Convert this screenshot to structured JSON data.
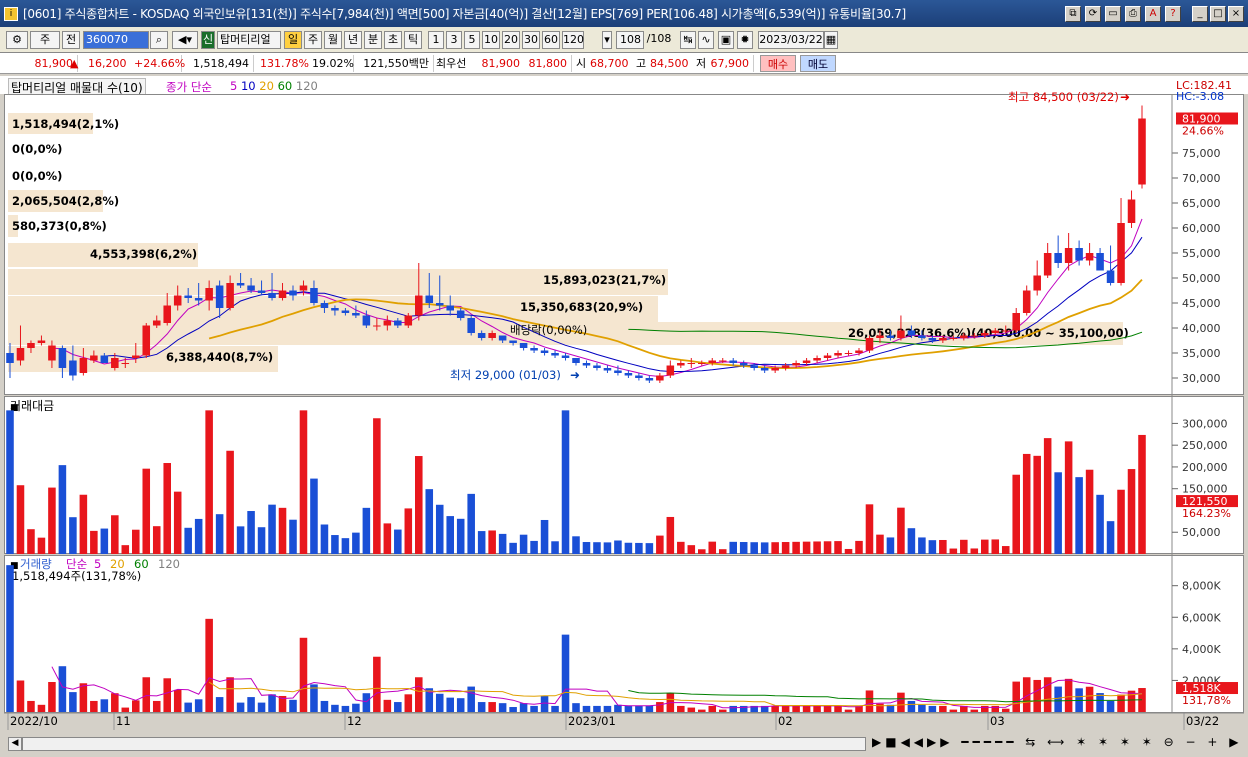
{
  "title": "[0601] 주식종합차트 - KOSDAQ 외국인보유[131(천)] 주식수[7,984(천)] 액면[500] 자본금[40(억)] 결산[12월] EPS[769] PER[106.48] 시가총액[6,539(억)] 유통비율[30.7]",
  "toolbar": {
    "period": "주",
    "code": "360070",
    "stock_name": "탑머티리얼",
    "timeframes": [
      "일",
      "주",
      "월",
      "년",
      "분",
      "초",
      "틱"
    ],
    "intervals": [
      "1",
      "3",
      "5",
      "10",
      "20",
      "30",
      "60",
      "120"
    ],
    "count": "108",
    "total": "/108",
    "date": "2023/03/22",
    "jeon": "전",
    "sin": "신"
  },
  "pricebar": {
    "price": "81,900",
    "arrow": "▲",
    "change": "16,200",
    "change_pct": "+24.66%",
    "volume": "1,518,494",
    "volume_ratio": "131.78%",
    "turnover": "19.02%",
    "amount": "121,550백만",
    "choiwoo": "최우선",
    "ask": "81,900",
    "bid": "81,800",
    "open_label": "시",
    "open": "68,700",
    "high_label": "고",
    "high": "84,500",
    "low_label": "저",
    "low": "67,900",
    "buy": "매수",
    "sell": "매도"
  },
  "legend": {
    "name": "탑머티리얼 매물대 수(10)",
    "ma_label": "종가 단순",
    "periods": [
      "5",
      "10",
      "20",
      "60",
      "120"
    ],
    "ma_colors": [
      "#c000c0",
      "#0000c0",
      "#e0a000",
      "#008000",
      "#808080"
    ]
  },
  "price_axis": {
    "lc": "LC:182.41",
    "hc": "HC:-3.08",
    "current": "81,900",
    "pct": "24.66%",
    "ticks": [
      "75,000",
      "70,000",
      "65,000",
      "60,000",
      "55,000",
      "50,000",
      "45,000",
      "40,000",
      "35,000",
      "30,000"
    ]
  },
  "volume_profile": [
    "1,518,494(2,1%)",
    "0(0,0%)",
    "0(0,0%)",
    "2,065,504(2,8%)",
    "580,373(0,8%)",
    "4,553,398(6,2%)",
    "15,893,023(21,7%)",
    "15,350,683(20,9%)",
    "6,388,440(8,7%)",
    "26,059,228(36,6%)(40,300,00 ~ 35,100,00)"
  ],
  "annotations": {
    "high": "최고 84,500 (03/22)",
    "low": "최저 29,000 (01/03)",
    "dividend": "배당락(0,00%)"
  },
  "amount_panel": {
    "title": "거래대금",
    "ticks": [
      "300,000",
      "250,000",
      "200,000",
      "150,000",
      "50,000"
    ],
    "current": "121,550",
    "pct": "164.23%"
  },
  "volume_panel": {
    "title": "거래량",
    "ma_label": "단순",
    "periods": [
      "5",
      "20",
      "60",
      "120"
    ],
    "value_text": "1,518,494주(131,78%)",
    "ticks": [
      "8,000K",
      "6,000K",
      "4,000K",
      "2,000K"
    ],
    "current": "1,518K",
    "pct": "131,78%"
  },
  "xaxis": [
    "2022/10",
    "11",
    "12",
    "2023/01",
    "02",
    "03",
    "03/22"
  ],
  "chart_data": {
    "type": "candlestick",
    "title": "탑머티리얼",
    "ylim": [
      26000,
      86000
    ],
    "candles": [
      [
        35000,
        37000,
        30000,
        33000
      ],
      [
        33500,
        40500,
        32500,
        36000
      ],
      [
        36000,
        37500,
        35000,
        37000
      ],
      [
        37000,
        38500,
        36500,
        37500
      ],
      [
        33500,
        37500,
        32000,
        36500
      ],
      [
        36000,
        36500,
        30000,
        32000
      ],
      [
        33500,
        36500,
        29500,
        30500
      ],
      [
        31000,
        36000,
        30500,
        34000
      ],
      [
        33500,
        35500,
        33000,
        34500
      ],
      [
        34500,
        35000,
        33000,
        33000
      ],
      [
        32000,
        35000,
        31500,
        34000
      ],
      [
        33000,
        34000,
        32000,
        33000
      ],
      [
        34000,
        37000,
        33000,
        34500
      ],
      [
        34500,
        41000,
        34000,
        40500
      ],
      [
        40500,
        42500,
        40000,
        41500
      ],
      [
        41000,
        47000,
        40500,
        44500
      ],
      [
        44500,
        48500,
        43500,
        46500
      ],
      [
        46500,
        48000,
        45000,
        46000
      ],
      [
        46000,
        49000,
        44500,
        45500
      ],
      [
        45500,
        49500,
        43500,
        48000
      ],
      [
        48500,
        49500,
        42000,
        44000
      ],
      [
        44000,
        50500,
        43500,
        49000
      ],
      [
        49000,
        51000,
        48000,
        48500
      ],
      [
        48500,
        50000,
        47000,
        47500
      ],
      [
        47500,
        49500,
        46500,
        47000
      ],
      [
        47000,
        51000,
        45500,
        46000
      ],
      [
        46000,
        49000,
        45500,
        47500
      ],
      [
        47500,
        48500,
        45500,
        46500
      ],
      [
        47500,
        49500,
        46500,
        48500
      ],
      [
        48000,
        49500,
        44500,
        45000
      ],
      [
        45000,
        45500,
        43000,
        44000
      ],
      [
        44000,
        44500,
        42500,
        43500
      ],
      [
        43500,
        44000,
        42500,
        43000
      ],
      [
        43000,
        44500,
        42000,
        42500
      ],
      [
        42500,
        43500,
        40000,
        40500
      ],
      [
        40500,
        42000,
        39500,
        40500
      ],
      [
        40500,
        42500,
        39500,
        41500
      ],
      [
        41500,
        42000,
        40000,
        40500
      ],
      [
        40500,
        43000,
        40000,
        42500
      ],
      [
        42500,
        53000,
        41500,
        46500
      ],
      [
        46500,
        51000,
        44000,
        45000
      ],
      [
        45000,
        50500,
        43500,
        44500
      ],
      [
        44500,
        46500,
        42500,
        43500
      ],
      [
        43500,
        44000,
        41500,
        42000
      ],
      [
        42000,
        42500,
        38500,
        39000
      ],
      [
        39000,
        39500,
        37500,
        38000
      ],
      [
        38000,
        39500,
        37500,
        39000
      ],
      [
        38500,
        38500,
        37000,
        37500
      ],
      [
        37500,
        37500,
        36500,
        37000
      ],
      [
        37000,
        37000,
        35500,
        36000
      ],
      [
        36000,
        36500,
        35000,
        35500
      ],
      [
        35500,
        36000,
        34500,
        35000
      ],
      [
        35000,
        35500,
        34000,
        34500
      ],
      [
        34500,
        35000,
        33500,
        34000
      ],
      [
        34000,
        34000,
        32500,
        33000
      ],
      [
        33000,
        33500,
        32000,
        32500
      ],
      [
        32500,
        33000,
        31500,
        32000
      ],
      [
        32000,
        32500,
        31000,
        31500
      ],
      [
        31500,
        32500,
        30500,
        31000
      ],
      [
        31000,
        31500,
        30000,
        30500
      ],
      [
        30500,
        31000,
        29500,
        30000
      ],
      [
        30000,
        30500,
        29000,
        29500
      ],
      [
        29500,
        31000,
        29000,
        30500
      ],
      [
        30500,
        33500,
        30000,
        32500
      ],
      [
        32500,
        33500,
        32000,
        33000
      ],
      [
        33000,
        34000,
        32000,
        33000
      ],
      [
        33000,
        33500,
        32500,
        33000
      ],
      [
        33000,
        34000,
        32500,
        33500
      ],
      [
        33500,
        34000,
        33000,
        33500
      ],
      [
        33500,
        34000,
        32500,
        33000
      ],
      [
        33000,
        33500,
        32000,
        32500
      ],
      [
        32500,
        33000,
        31500,
        32000
      ],
      [
        32000,
        32500,
        31000,
        31500
      ],
      [
        31500,
        32500,
        31000,
        32000
      ],
      [
        32000,
        33000,
        31500,
        32500
      ],
      [
        32500,
        33500,
        32000,
        33000
      ],
      [
        33000,
        34000,
        32500,
        33500
      ],
      [
        33500,
        34500,
        33000,
        34000
      ],
      [
        34000,
        35000,
        33500,
        34500
      ],
      [
        34500,
        35500,
        34000,
        35000
      ],
      [
        35000,
        35500,
        34500,
        35000
      ],
      [
        35000,
        36000,
        34500,
        35500
      ],
      [
        35500,
        38500,
        35000,
        38000
      ],
      [
        38000,
        39500,
        37000,
        38500
      ],
      [
        38500,
        39500,
        37500,
        38000
      ],
      [
        38000,
        42500,
        37500,
        39500
      ],
      [
        39500,
        40500,
        38000,
        38500
      ],
      [
        38500,
        39500,
        37500,
        38000
      ],
      [
        38000,
        38500,
        37000,
        37500
      ],
      [
        37500,
        38500,
        37000,
        38000
      ],
      [
        38000,
        38500,
        37500,
        38000
      ],
      [
        38000,
        39000,
        37500,
        38500
      ],
      [
        38500,
        39000,
        38000,
        38500
      ],
      [
        38500,
        39500,
        38000,
        39000
      ],
      [
        39000,
        40000,
        38500,
        39500
      ],
      [
        39500,
        40500,
        39000,
        39500
      ],
      [
        39500,
        44000,
        39000,
        43000
      ],
      [
        43000,
        48500,
        42500,
        47500
      ],
      [
        47500,
        53500,
        46500,
        50500
      ],
      [
        50500,
        57000,
        50000,
        55000
      ],
      [
        55000,
        58500,
        52000,
        53000
      ],
      [
        53000,
        59000,
        51500,
        56000
      ],
      [
        56000,
        57500,
        52500,
        53500
      ],
      [
        53500,
        57000,
        52500,
        55000
      ],
      [
        55000,
        56000,
        51500,
        51500
      ],
      [
        51500,
        56500,
        48500,
        49000
      ],
      [
        49000,
        66000,
        48500,
        61000
      ],
      [
        61000,
        67500,
        60000,
        65700
      ],
      [
        68700,
        84500,
        67900,
        81900
      ]
    ]
  }
}
